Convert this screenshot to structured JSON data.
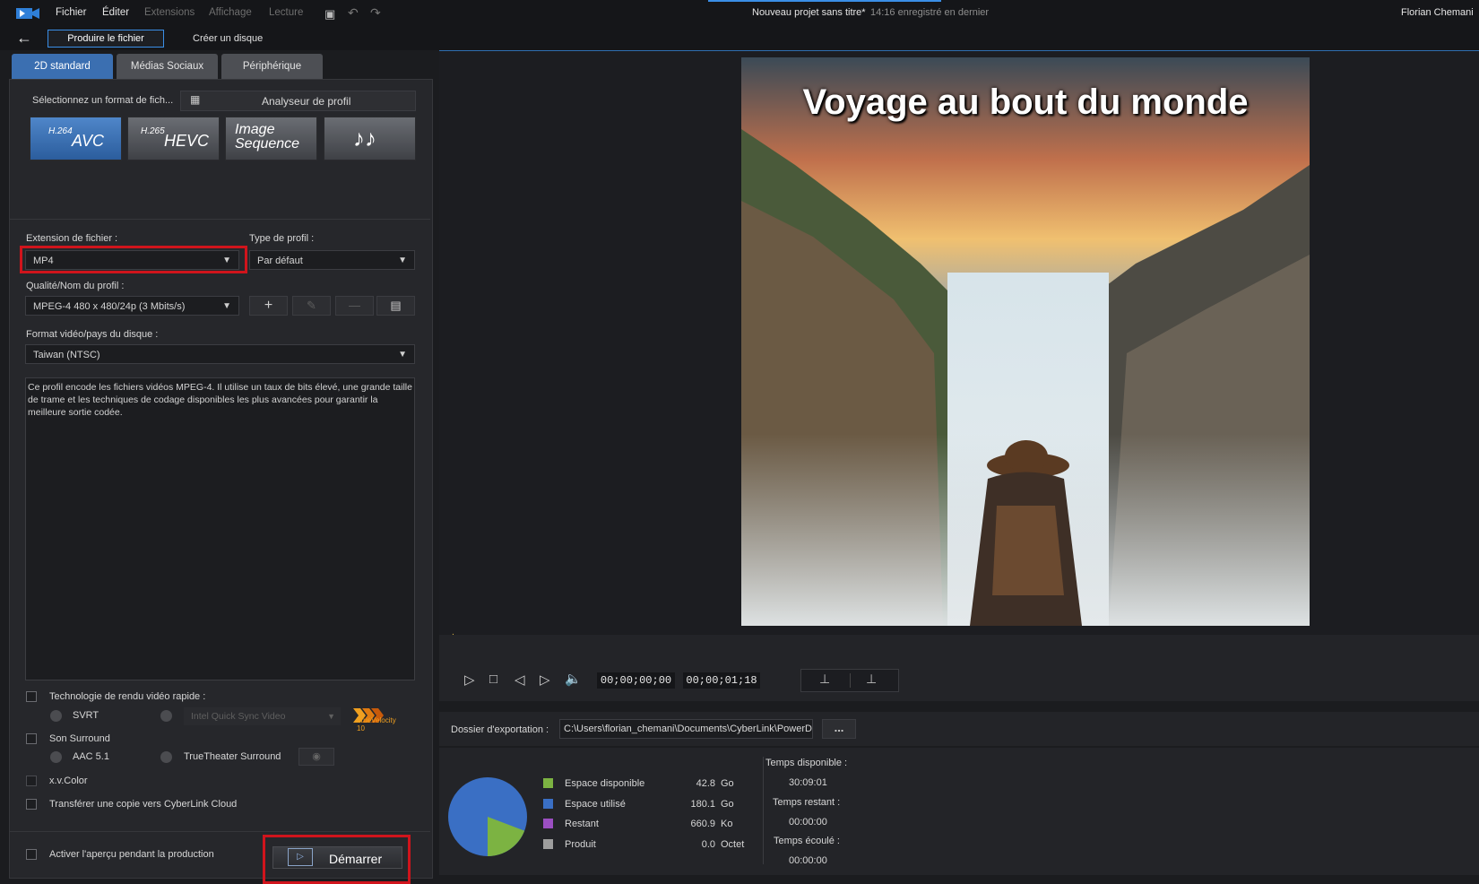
{
  "menubar": {
    "file": "Fichier",
    "edit": "Éditer",
    "extensions": "Extensions",
    "view": "Affichage",
    "playback": "Lecture",
    "project_title": "Nouveau projet sans titre*",
    "save_status": "14:16 enregistré en dernier",
    "user": "Florian Chemani"
  },
  "subbar": {
    "produce_file": "Produire le fichier",
    "create_disc": "Créer un disque"
  },
  "tabs": [
    "2D standard",
    "Médias Sociaux",
    "Périphérique"
  ],
  "format": {
    "select_label": "Sélectionnez un format de fich...",
    "profile_analyzer": "Analyseur de profil",
    "buttons": [
      {
        "sup": "H.264",
        "main": "AVC"
      },
      {
        "sup": "H.265",
        "main": "HEVC"
      },
      {
        "sup": "",
        "main": "Image Sequence"
      },
      {
        "sup": "",
        "main": "♪♪"
      }
    ]
  },
  "settings": {
    "ext_label": "Extension de fichier :",
    "ext_value": "MP4",
    "profile_type_label": "Type de profil :",
    "profile_type_value": "Par défaut",
    "quality_label": "Qualité/Nom du profil :",
    "quality_value": "MPEG-4 480 x 480/24p (3 Mbits/s)",
    "disc_format_label": "Format vidéo/pays du disque :",
    "disc_format_value": "Taiwan (NTSC)",
    "description": "Ce profil encode les fichiers vidéos MPEG-4.  Il utilise un taux de bits élevé, une grande taille de trame et les techniques de codage disponibles les plus avancées pour garantir la meilleure sortie codée."
  },
  "options": {
    "fast_render": "Technologie de rendu vidéo rapide :",
    "svrt": "SVRT",
    "intel": "Intel Quick Sync Video",
    "velocity": "TrueVelocity 10",
    "surround": "Son Surround",
    "aac": "AAC 5.1",
    "truetheater": "TrueTheater Surround",
    "xvcolor": "x.v.Color",
    "cloud": "Transférer une copie vers CyberLink Cloud",
    "preview_during": "Activer l'aperçu pendant la production",
    "start": "Démarrer"
  },
  "preview": {
    "title_overlay": "Voyage au bout du monde"
  },
  "playback": {
    "current_time": "00;00;00;00",
    "total_time": "00;00;01;18",
    "progress": 0.0
  },
  "export": {
    "folder_label": "Dossier d'exportation :",
    "folder_path": "C:\\Users\\florian_chemani\\Documents\\CyberLink\\PowerDirector",
    "browse": "..."
  },
  "disk": {
    "rows": [
      {
        "label": "Espace disponible",
        "value": "42.8",
        "unit": "Go",
        "color": "#7cb342"
      },
      {
        "label": "Espace utilisé",
        "value": "180.1",
        "unit": "Go",
        "color": "#3a6fc4"
      },
      {
        "label": "Restant",
        "value": "660.9",
        "unit": "Ko",
        "color": "#9b4fc2"
      },
      {
        "label": "Produit",
        "value": "0.0",
        "unit": "Octet",
        "color": "#9e9e9e"
      }
    ],
    "time_available_label": "Temps disponible :",
    "time_available": "30:09:01",
    "time_remaining_label": "Temps restant :",
    "time_remaining": "00:00:00",
    "time_elapsed_label": "Temps écoulé :",
    "time_elapsed": "00:00:00"
  },
  "colors": {
    "accent": "#3b6fb1",
    "highlight": "#d0141c"
  }
}
